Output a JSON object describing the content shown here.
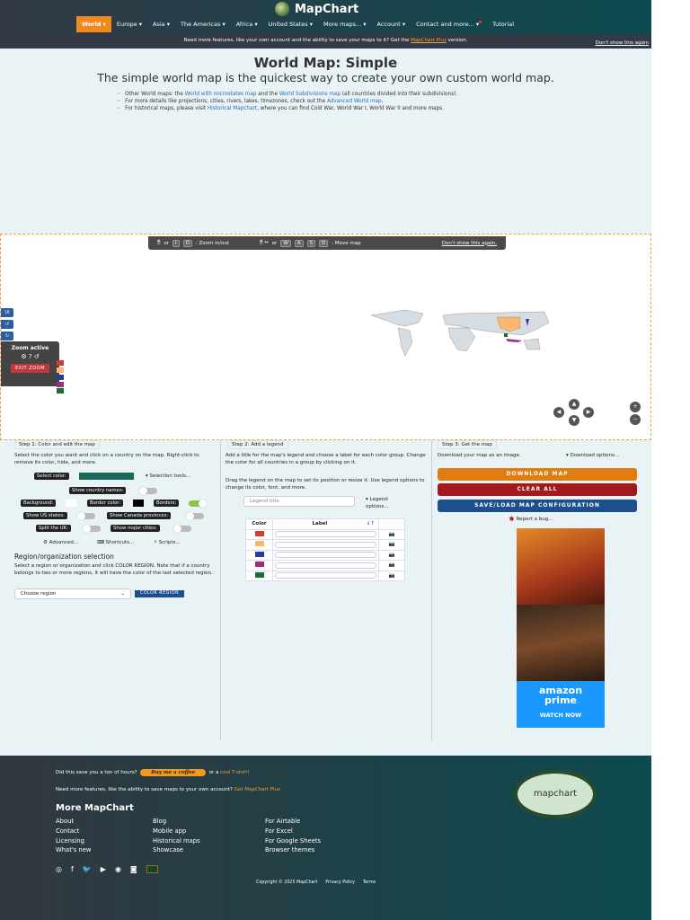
{
  "header": {
    "title": "MapChart",
    "nav": [
      "World",
      "Europe",
      "Asia",
      "The Americas",
      "Africa",
      "United States",
      "More maps...",
      "Account",
      "Contact and more...",
      "Tutorial"
    ]
  },
  "banner": {
    "text": "Need more features, like your own account and the ability to save your maps to it? Get the",
    "link": "MapChart Plus",
    "suffix": "version.",
    "dismiss": "Don't show this again"
  },
  "page": {
    "title": "World Map: Simple",
    "subtitle": "The simple world map is the quickest way to create your own custom world map.",
    "bullets": [
      {
        "pre": "Other World maps: the ",
        "l1": "World with microstates map",
        "mid": " and the ",
        "l2": "World Subdivisions map",
        "post": " (all countries divided into their subdivisions)."
      },
      {
        "pre": "For more details like projections, cities, rivers, lakes, timezones, check out the ",
        "l1": "Advanced World map",
        "post": "."
      },
      {
        "pre": "For historical maps, please visit ",
        "l1": "Historical Mapchart",
        "post": ", where you can find Cold War, World War I, World War II and more maps."
      }
    ]
  },
  "map": {
    "hint": {
      "or1": "or",
      "k1": "I",
      "k2": "O",
      "zoom": ": Zoom in/out",
      "or2": "or",
      "keys": [
        "W",
        "A",
        "S",
        "D"
      ],
      "move": ": Move map",
      "dismiss": "Don't show this again."
    },
    "side": [
      "UI",
      "↺",
      "↻"
    ],
    "zoom_active": "Zoom active",
    "exit_zoom": "EXIT ZOOM",
    "colors": [
      "#d63a34",
      "#fbb86b",
      "#283a9a",
      "#9a2f7a",
      "#1a6f38"
    ],
    "highlight": "#fbb86b"
  },
  "step1": {
    "tab": "Step 1: Color and edit the map",
    "desc": "Select the color you want and click on a country on the map. Right-click to remove its color, hide, and more.",
    "select_color": "Select color:",
    "selected_color": "#1a6a5c",
    "selection_tools": "▾ Selection tools...",
    "show_names": "Show country names:",
    "background": "Background:",
    "border_color": "Border color:",
    "borders": "Borders:",
    "us_states": "Show US states:",
    "canada": "Show Canada provinces:",
    "split_uk": "Split the UK:",
    "cities": "Show major cities:",
    "advanced": "⚙ Advanced...",
    "shortcuts": "⌨ Shortcuts...",
    "scripts": "⚡ Scripts...",
    "region_title": "Region/organization selection",
    "region_desc": "Select a region or organization and click COLOR REGION. Note that if a country belongs to two or more regions, it will have the color of the last selected region.",
    "region_placeholder": "Choose region",
    "color_region": "COLOR REGION"
  },
  "step2": {
    "tab": "Step 2: Add a legend",
    "desc1": "Add a title for the map's legend and choose a label for each color group. Change the color for all countries in a group by clicking on it.",
    "desc2": "Drag the legend on the map to set its position or resize it. Use legend options to change its color, font, and more.",
    "title_placeholder": "Legend title",
    "options": "▾ Legend options...",
    "col_color": "Color",
    "col_label": "Label",
    "sort": "↓↑"
  },
  "step3": {
    "tab": "Step 3: Get the map",
    "desc": "Download your map as an image.",
    "download_options": "▾ Download options...",
    "download": "DOWNLOAD MAP",
    "clear": "CLEAR ALL",
    "save": "SAVE/LOAD MAP CONFIGURATION",
    "bug": "🐞 Report a bug...",
    "ad_brand": "amazon",
    "ad_brand2": "prime",
    "ad_cta": "WATCH NOW"
  },
  "footer": {
    "q": "Did this save you a ton of hours?",
    "coffee": "Buy me a coffee",
    "or": "or a",
    "tshirt": "cool T-shirt!",
    "plus_q": "Need more features, like the ability to save maps to your own account?",
    "plus": "Get MapChart Plus",
    "more": "More MapChart",
    "col1": [
      "About",
      "Contact",
      "Licensing",
      "What's new"
    ],
    "col2": [
      "Blog",
      "Mobile app",
      "Historical maps",
      "Showcase"
    ],
    "col3": [
      "For Airtable",
      "For Excel",
      "For Google Sheets",
      "Browser themes"
    ],
    "copyright": "Copyright © 2025 MapChart",
    "privacy": "Privacy Policy",
    "terms": "Terms",
    "logo": "mapchart"
  }
}
